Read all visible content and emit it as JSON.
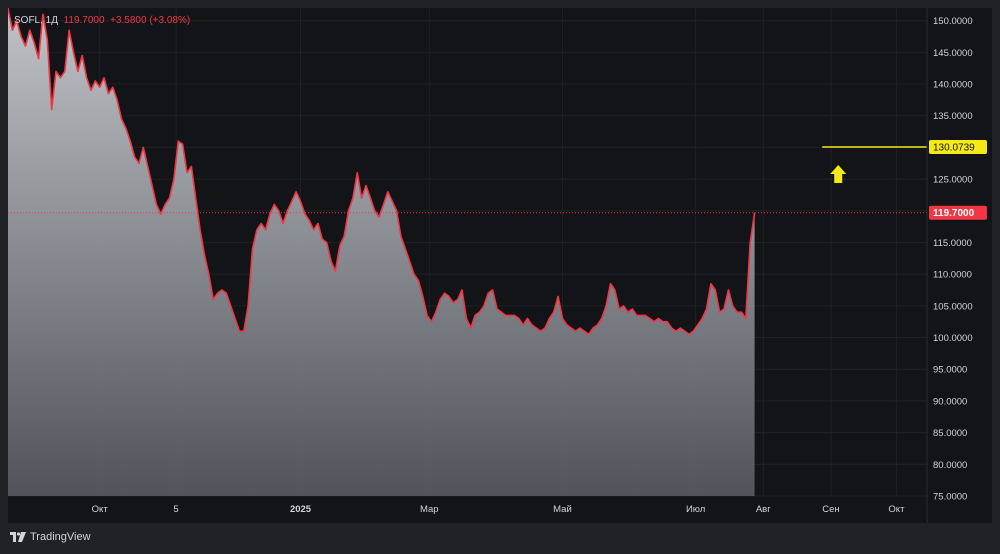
{
  "header": {
    "symbol": "SOFL, 1Д",
    "price": "119.7000",
    "change": "+3.5800 (+3.08%)"
  },
  "branding": {
    "label": "TradingView"
  },
  "colors": {
    "line": "#f23645",
    "target": "#f5ea15",
    "bg": "#131417",
    "frame": "#202226"
  },
  "chart_data": {
    "type": "area",
    "y_ticks": [
      "150.0000",
      "145.0000",
      "140.0000",
      "135.0000",
      "130.0000",
      "125.0000",
      "120.0000",
      "115.0000",
      "110.0000",
      "105.0000",
      "100.0000",
      "95.0000",
      "90.0000",
      "85.0000",
      "80.0000",
      "75.0000"
    ],
    "y_range": [
      75,
      152
    ],
    "x_ticks": [
      {
        "label": "Окт",
        "date": "2024-10-01"
      },
      {
        "label": "5",
        "date": "2024-11-05"
      },
      {
        "label": "2025",
        "date": "2025-01-01"
      },
      {
        "label": "Мар",
        "date": "2025-03-01"
      },
      {
        "label": "Май",
        "date": "2025-05-01"
      },
      {
        "label": "Июл",
        "date": "2025-07-01"
      },
      {
        "label": "Авг",
        "date": "2025-08-01"
      },
      {
        "label": "Сен",
        "date": "2025-09-01"
      },
      {
        "label": "Окт",
        "date": "2025-10-01"
      }
    ],
    "x_range": [
      "2024-08-20",
      "2025-10-15"
    ],
    "current_price": {
      "label": "119.7000",
      "value": 119.7
    },
    "target_price": {
      "label": "130.0739",
      "value": 130.0739,
      "from": "2025-08-28",
      "to": "2025-10-15",
      "arrow": "up"
    },
    "series": [
      {
        "points": [
          [
            "2024-08-20",
            152.0
          ],
          [
            "2024-08-22",
            148.5
          ],
          [
            "2024-08-24",
            150.0
          ],
          [
            "2024-08-26",
            147.5
          ],
          [
            "2024-08-28",
            146.0
          ],
          [
            "2024-08-30",
            148.5
          ],
          [
            "2024-09-01",
            146.5
          ],
          [
            "2024-09-03",
            144.0
          ],
          [
            "2024-09-05",
            151.0
          ],
          [
            "2024-09-07",
            147.0
          ],
          [
            "2024-09-09",
            136.0
          ],
          [
            "2024-09-11",
            142.0
          ],
          [
            "2024-09-13",
            141.0
          ],
          [
            "2024-09-15",
            142.0
          ],
          [
            "2024-09-17",
            148.5
          ],
          [
            "2024-09-19",
            145.0
          ],
          [
            "2024-09-21",
            142.0
          ],
          [
            "2024-09-23",
            144.5
          ],
          [
            "2024-09-25",
            141.0
          ],
          [
            "2024-09-27",
            139.0
          ],
          [
            "2024-09-29",
            140.5
          ],
          [
            "2024-10-01",
            139.5
          ],
          [
            "2024-10-03",
            141.0
          ],
          [
            "2024-10-05",
            138.5
          ],
          [
            "2024-10-07",
            139.5
          ],
          [
            "2024-10-09",
            137.5
          ],
          [
            "2024-10-11",
            134.5
          ],
          [
            "2024-10-13",
            133.0
          ],
          [
            "2024-10-15",
            131.0
          ],
          [
            "2024-10-17",
            128.5
          ],
          [
            "2024-10-19",
            127.5
          ],
          [
            "2024-10-21",
            130.0
          ],
          [
            "2024-10-23",
            127.0
          ],
          [
            "2024-10-25",
            124.0
          ],
          [
            "2024-10-27",
            121.0
          ],
          [
            "2024-10-29",
            119.5
          ],
          [
            "2024-10-31",
            121.0
          ],
          [
            "2024-11-02",
            122.0
          ],
          [
            "2024-11-04",
            125.0
          ],
          [
            "2024-11-06",
            131.0
          ],
          [
            "2024-11-08",
            130.5
          ],
          [
            "2024-11-10",
            126.0
          ],
          [
            "2024-11-12",
            127.0
          ],
          [
            "2024-11-14",
            122.0
          ],
          [
            "2024-11-16",
            117.0
          ],
          [
            "2024-11-18",
            113.0
          ],
          [
            "2024-11-20",
            110.0
          ],
          [
            "2024-11-22",
            106.0
          ],
          [
            "2024-11-24",
            107.0
          ],
          [
            "2024-11-26",
            107.5
          ],
          [
            "2024-11-28",
            107.0
          ],
          [
            "2024-11-30",
            105.0
          ],
          [
            "2024-12-02",
            103.0
          ],
          [
            "2024-12-04",
            101.0
          ],
          [
            "2024-12-06",
            101.0
          ],
          [
            "2024-12-08",
            105.0
          ],
          [
            "2024-12-10",
            114.0
          ],
          [
            "2024-12-12",
            117.0
          ],
          [
            "2024-12-14",
            118.0
          ],
          [
            "2024-12-16",
            117.0
          ],
          [
            "2024-12-18",
            119.5
          ],
          [
            "2024-12-20",
            121.0
          ],
          [
            "2024-12-22",
            120.0
          ],
          [
            "2024-12-24",
            118.0
          ],
          [
            "2024-12-26",
            120.0
          ],
          [
            "2024-12-28",
            121.5
          ],
          [
            "2024-12-30",
            123.0
          ],
          [
            "2025-01-01",
            121.5
          ],
          [
            "2025-01-03",
            119.5
          ],
          [
            "2025-01-05",
            118.5
          ],
          [
            "2025-01-07",
            117.0
          ],
          [
            "2025-01-09",
            118.0
          ],
          [
            "2025-01-11",
            115.5
          ],
          [
            "2025-01-13",
            115.0
          ],
          [
            "2025-01-15",
            112.0
          ],
          [
            "2025-01-17",
            110.5
          ],
          [
            "2025-01-19",
            114.5
          ],
          [
            "2025-01-21",
            116.0
          ],
          [
            "2025-01-23",
            120.0
          ],
          [
            "2025-01-25",
            122.0
          ],
          [
            "2025-01-27",
            126.0
          ],
          [
            "2025-01-29",
            122.0
          ],
          [
            "2025-01-31",
            124.0
          ],
          [
            "2025-02-02",
            122.0
          ],
          [
            "2025-02-04",
            120.0
          ],
          [
            "2025-02-06",
            119.0
          ],
          [
            "2025-02-08",
            121.0
          ],
          [
            "2025-02-10",
            123.0
          ],
          [
            "2025-02-12",
            121.5
          ],
          [
            "2025-02-14",
            120.0
          ],
          [
            "2025-02-16",
            116.0
          ],
          [
            "2025-02-18",
            114.0
          ],
          [
            "2025-02-20",
            112.0
          ],
          [
            "2025-02-22",
            110.0
          ],
          [
            "2025-02-24",
            109.0
          ],
          [
            "2025-02-26",
            106.5
          ],
          [
            "2025-02-28",
            103.5
          ],
          [
            "2025-03-02",
            102.5
          ],
          [
            "2025-03-04",
            104.0
          ],
          [
            "2025-03-06",
            106.0
          ],
          [
            "2025-03-08",
            107.0
          ],
          [
            "2025-03-10",
            106.5
          ],
          [
            "2025-03-12",
            105.5
          ],
          [
            "2025-03-14",
            106.0
          ],
          [
            "2025-03-16",
            107.5
          ],
          [
            "2025-03-18",
            103.0
          ],
          [
            "2025-03-20",
            101.5
          ],
          [
            "2025-03-22",
            103.5
          ],
          [
            "2025-03-24",
            104.0
          ],
          [
            "2025-03-26",
            105.0
          ],
          [
            "2025-03-28",
            107.0
          ],
          [
            "2025-03-30",
            107.5
          ],
          [
            "2025-04-01",
            104.5
          ],
          [
            "2025-04-03",
            104.0
          ],
          [
            "2025-04-05",
            103.5
          ],
          [
            "2025-04-07",
            103.5
          ],
          [
            "2025-04-09",
            103.5
          ],
          [
            "2025-04-11",
            103.0
          ],
          [
            "2025-04-13",
            102.0
          ],
          [
            "2025-04-15",
            103.0
          ],
          [
            "2025-04-17",
            102.0
          ],
          [
            "2025-04-19",
            101.5
          ],
          [
            "2025-04-21",
            101.0
          ],
          [
            "2025-04-23",
            101.5
          ],
          [
            "2025-04-25",
            103.0
          ],
          [
            "2025-04-27",
            104.0
          ],
          [
            "2025-04-29",
            106.5
          ],
          [
            "2025-05-01",
            103.0
          ],
          [
            "2025-05-03",
            102.0
          ],
          [
            "2025-05-05",
            101.5
          ],
          [
            "2025-05-07",
            101.0
          ],
          [
            "2025-05-09",
            101.5
          ],
          [
            "2025-05-11",
            101.0
          ],
          [
            "2025-05-13",
            100.5
          ],
          [
            "2025-05-15",
            101.5
          ],
          [
            "2025-05-17",
            102.0
          ],
          [
            "2025-05-19",
            103.0
          ],
          [
            "2025-05-21",
            105.0
          ],
          [
            "2025-05-23",
            108.5
          ],
          [
            "2025-05-25",
            107.5
          ],
          [
            "2025-05-27",
            104.5
          ],
          [
            "2025-05-29",
            105.0
          ],
          [
            "2025-05-31",
            104.0
          ],
          [
            "2025-06-02",
            104.5
          ],
          [
            "2025-06-04",
            103.5
          ],
          [
            "2025-06-06",
            103.5
          ],
          [
            "2025-06-08",
            103.5
          ],
          [
            "2025-06-10",
            103.0
          ],
          [
            "2025-06-12",
            102.5
          ],
          [
            "2025-06-14",
            103.0
          ],
          [
            "2025-06-16",
            102.5
          ],
          [
            "2025-06-18",
            102.5
          ],
          [
            "2025-06-20",
            101.5
          ],
          [
            "2025-06-22",
            101.0
          ],
          [
            "2025-06-24",
            101.5
          ],
          [
            "2025-06-26",
            101.0
          ],
          [
            "2025-06-28",
            100.5
          ],
          [
            "2025-06-30",
            101.0
          ],
          [
            "2025-07-02",
            102.0
          ],
          [
            "2025-07-04",
            103.0
          ],
          [
            "2025-07-06",
            104.5
          ],
          [
            "2025-07-08",
            108.5
          ],
          [
            "2025-07-10",
            107.5
          ],
          [
            "2025-07-12",
            104.0
          ],
          [
            "2025-07-14",
            104.5
          ],
          [
            "2025-07-16",
            107.5
          ],
          [
            "2025-07-18",
            105.0
          ],
          [
            "2025-07-20",
            104.0
          ],
          [
            "2025-07-22",
            104.0
          ],
          [
            "2025-07-24",
            103.0
          ],
          [
            "2025-07-26",
            115.0
          ],
          [
            "2025-07-28",
            119.7
          ]
        ]
      }
    ]
  }
}
